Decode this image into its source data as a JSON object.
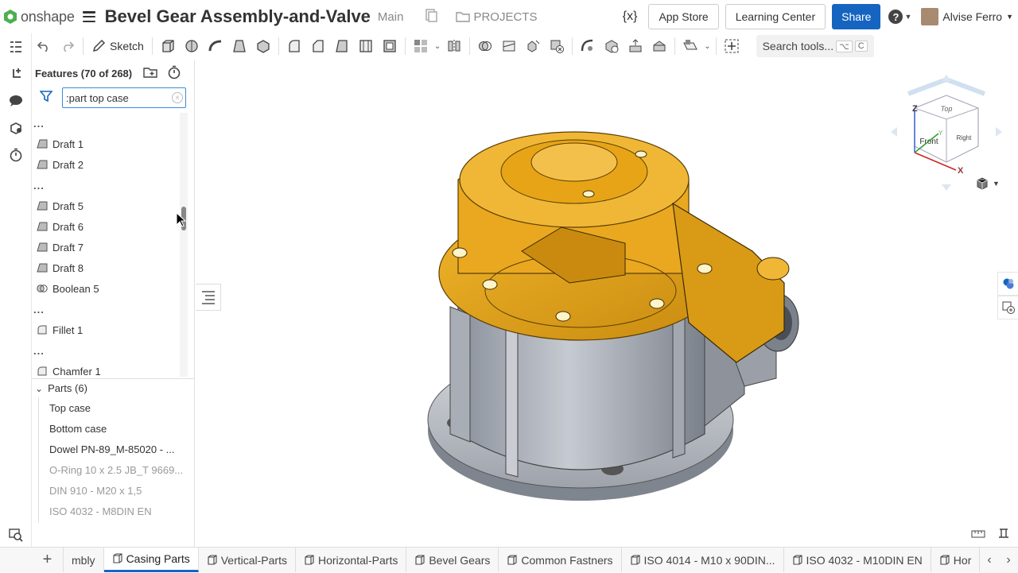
{
  "app": {
    "logo_text": "onshape"
  },
  "header": {
    "doc_title": "Bevel Gear Assembly-and-Valve",
    "branch": "Main",
    "projects_label": "PROJECTS",
    "variable_label": "{x}",
    "app_store_label": "App Store",
    "learning_center_label": "Learning Center",
    "share_label": "Share",
    "help_label": "?",
    "user_name": "Alvise Ferro"
  },
  "toolbar": {
    "sketch_label": "Sketch",
    "search_label": "Search tools...",
    "search_shortcut_1": "⌥",
    "search_shortcut_2": "C"
  },
  "features_panel": {
    "title": "Features (70 of 268)",
    "filter_value": ":part top case",
    "items": [
      {
        "label": "...",
        "type": "dots"
      },
      {
        "label": "Draft 1",
        "type": "draft"
      },
      {
        "label": "Draft 2",
        "type": "draft"
      },
      {
        "label": "...",
        "type": "dots"
      },
      {
        "label": "Draft 5",
        "type": "draft"
      },
      {
        "label": "Draft 6",
        "type": "draft"
      },
      {
        "label": "Draft 7",
        "type": "draft"
      },
      {
        "label": "Draft 8",
        "type": "draft"
      },
      {
        "label": "Boolean 5",
        "type": "boolean"
      },
      {
        "label": "...",
        "type": "dots"
      },
      {
        "label": "Fillet 1",
        "type": "fillet"
      },
      {
        "label": "...",
        "type": "dots"
      },
      {
        "label": "Chamfer 1",
        "type": "fillet"
      }
    ]
  },
  "parts": {
    "header": "Parts (6)",
    "items": [
      {
        "label": "Top case",
        "dim": false
      },
      {
        "label": "Bottom case",
        "dim": false
      },
      {
        "label": "Dowel PN-89_M-85020 - ...",
        "dim": false
      },
      {
        "label": "O-Ring 10 x 2.5 JB_T 9669...",
        "dim": true
      },
      {
        "label": "DIN 910 - M20 x 1,5",
        "dim": true
      },
      {
        "label": "ISO 4032 - M8DIN EN",
        "dim": true
      }
    ]
  },
  "viewcube": {
    "top": "Top",
    "front": "Front",
    "right": "Right",
    "z": "Z",
    "x": "X",
    "y": "Y"
  },
  "tabs": [
    {
      "label": "mbly",
      "active": false
    },
    {
      "label": "Casing Parts",
      "active": true
    },
    {
      "label": "Vertical-Parts",
      "active": false
    },
    {
      "label": "Horizontal-Parts",
      "active": false
    },
    {
      "label": "Bevel Gears",
      "active": false
    },
    {
      "label": "Common Fastners",
      "active": false
    },
    {
      "label": "ISO 4014 - M10 x 90DIN...",
      "active": false
    },
    {
      "label": "ISO 4032 - M10DIN EN",
      "active": false
    },
    {
      "label": "Hor",
      "active": false
    }
  ],
  "colors": {
    "accent": "#1565c0",
    "part_highlight": "#e8a51c",
    "body_grey": "#b8bcc4"
  }
}
